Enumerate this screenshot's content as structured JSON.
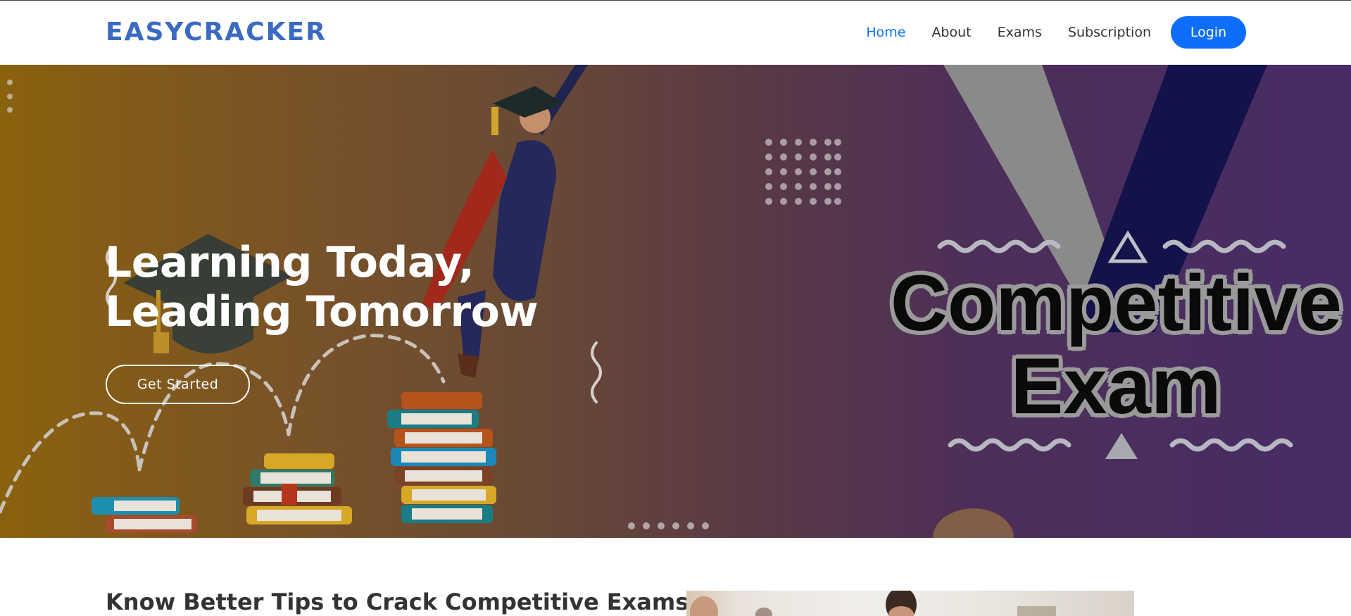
{
  "brand": {
    "logo_text": "EASYCRACKER"
  },
  "nav": {
    "items": [
      {
        "label": "Home",
        "active": true
      },
      {
        "label": "About",
        "active": false
      },
      {
        "label": "Exams",
        "active": false
      },
      {
        "label": "Subscription",
        "active": false
      }
    ],
    "login_label": "Login"
  },
  "hero": {
    "title_line1": "Learning Today,",
    "title_line2": "Leading Tomorrow",
    "cta_label": "Get Started",
    "badge_line1": "Competitive",
    "badge_line2": "Exam"
  },
  "section": {
    "heading": "Know Better Tips to Crack Competitive Exams"
  },
  "colors": {
    "brand": "#3b6ac2",
    "accent": "#0d6efd",
    "hero_left": "#8a620e",
    "hero_right": "#472c66"
  },
  "icons": [
    "graduation-student-illustration",
    "book-stack-illustration",
    "graduation-cap-illustration"
  ]
}
